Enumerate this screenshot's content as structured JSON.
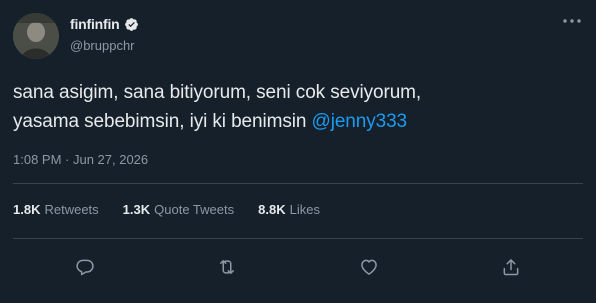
{
  "tweet": {
    "author": {
      "display_name": "finfinfin",
      "handle": "@bruppchr",
      "verified": true
    },
    "text_line1": "sana asigim, sana bitiyorum, seni cok seviyorum,",
    "text_line2": "yasama sebebimsin, iyi ki benimsin ",
    "mention": "@jenny333",
    "timestamp": "1:08 PM · Jun 27, 2026",
    "stats": {
      "retweets": {
        "count": "1.8K",
        "label": "Retweets"
      },
      "quote_tweets": {
        "count": "1.3K",
        "label": "Quote Tweets"
      },
      "likes": {
        "count": "8.8K",
        "label": "Likes"
      }
    },
    "icons": [
      "more-icon",
      "verified-icon",
      "reply-icon",
      "retweet-icon",
      "like-icon",
      "share-icon"
    ]
  },
  "colors": {
    "background": "#15202b",
    "text": "#e7e9ea",
    "secondary": "#8b98a5",
    "accent": "#1d9bf0",
    "divider": "#38444d"
  }
}
